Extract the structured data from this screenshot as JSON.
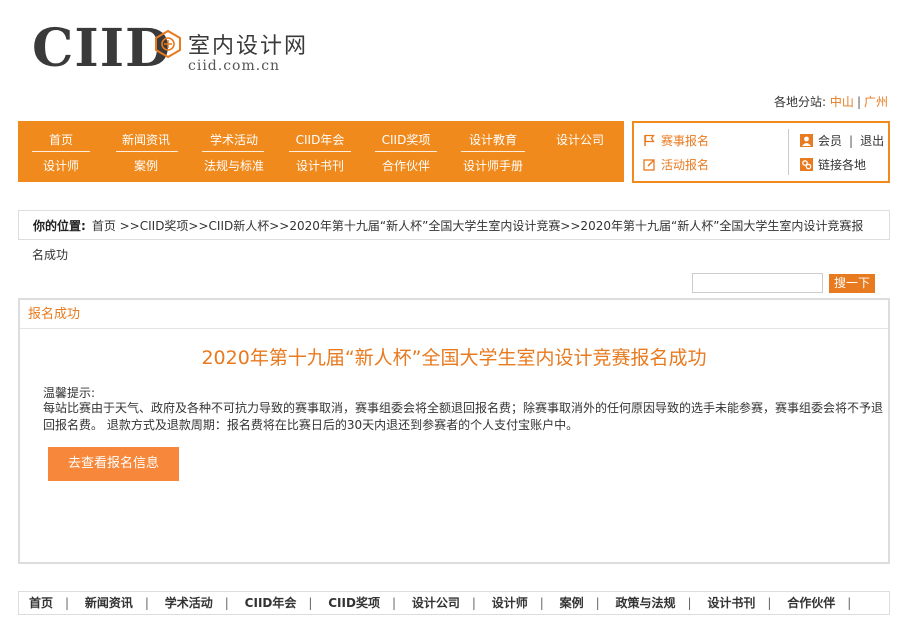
{
  "logo": {
    "mark": "CIID",
    "name_cn": "室内设计网",
    "url": "ciid.com.cn"
  },
  "sites": {
    "label": "各地分站:",
    "items": [
      "中山",
      "广州"
    ]
  },
  "nav": {
    "row1": [
      "首页",
      "新闻资讯",
      "学术活动",
      "CIID年会",
      "CIID奖项",
      "设计教育",
      "设计公司"
    ],
    "row2": [
      "设计师",
      "案例",
      "法规与标准",
      "设计书刊",
      "合作伙伴",
      "设计师手册"
    ]
  },
  "quick": {
    "contest_signup": "赛事报名",
    "event_signup": "活动报名",
    "member": "会员",
    "logout": "退出",
    "local_links": "链接各地"
  },
  "breadcrumb": {
    "label": "你的位置:",
    "path": "首页 >>CIID奖项>>CIID新人杯>>2020年第十九届“新人杯”全国大学生室内设计竞赛>>2020年第十九届“新人杯”全国大学生室内设计竞赛报",
    "continued": "名成功"
  },
  "search": {
    "value": "",
    "button": "搜一下"
  },
  "panel": {
    "header": "报名成功",
    "title": "2020年第十九届“新人杯”全国大学生室内设计竞赛报名成功",
    "notice_label": "温馨提示:",
    "notice_text": "每站比赛由于天气、政府及各种不可抗力导致的赛事取消，赛事组委会将全额退回报名费；除赛事取消外的任何原因导致的选手未能参赛，赛事组委会将不予退回报名费。 退款方式及退款周期：报名费将在比赛日后的30天内退还到参赛者的个人支付宝账户中。",
    "button": "去查看报名信息"
  },
  "footer": {
    "items": [
      "首页",
      "新闻资讯",
      "学术活动",
      "CIID年会",
      "CIID奖项",
      "设计公司",
      "设计师",
      "案例",
      "政策与法规",
      "设计书刊",
      "合作伙伴"
    ]
  },
  "colors": {
    "accent": "#f08a1c",
    "accent_text": "#e87a1f"
  }
}
